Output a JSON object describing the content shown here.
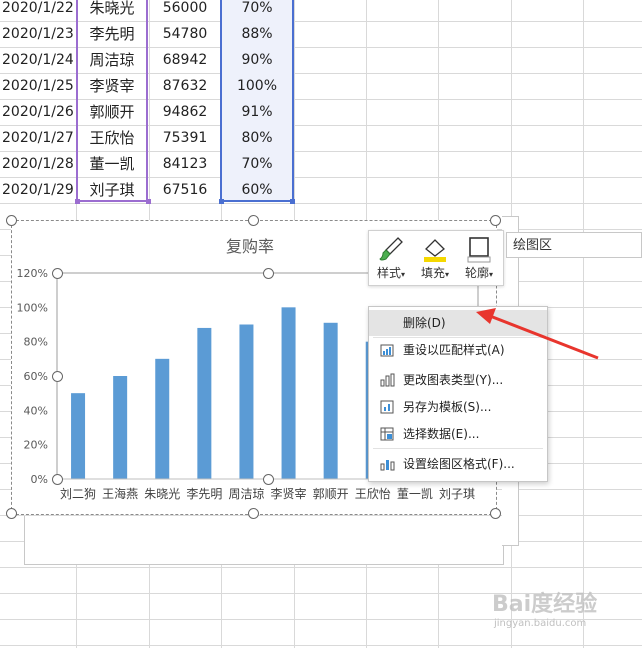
{
  "table": {
    "rows": [
      {
        "date": "2020/1/22",
        "name": "朱晓光",
        "value": "56000",
        "pct": "70%"
      },
      {
        "date": "2020/1/23",
        "name": "李先明",
        "value": "54780",
        "pct": "88%"
      },
      {
        "date": "2020/1/24",
        "name": "周洁琼",
        "value": "68942",
        "pct": "90%"
      },
      {
        "date": "2020/1/25",
        "name": "李贤宰",
        "value": "87632",
        "pct": "100%"
      },
      {
        "date": "2020/1/26",
        "name": "郭顺开",
        "value": "94862",
        "pct": "91%"
      },
      {
        "date": "2020/1/27",
        "name": "王欣怡",
        "value": "75391",
        "pct": "80%"
      },
      {
        "date": "2020/1/28",
        "name": "董一凯",
        "value": "84123",
        "pct": "70%"
      },
      {
        "date": "2020/1/29",
        "name": "刘子琪",
        "value": "67516",
        "pct": "60%"
      }
    ]
  },
  "chart_data": {
    "type": "bar",
    "title": "复购率",
    "categories": [
      "刘二狗",
      "王海燕",
      "朱晓光",
      "李先明",
      "周洁琼",
      "李贤宰",
      "郭顺开",
      "王欣怡",
      "董一凯",
      "刘子琪"
    ],
    "values": [
      0.5,
      0.6,
      0.7,
      0.88,
      0.9,
      1.0,
      0.91,
      0.8,
      0.7,
      0.6
    ],
    "yticks": [
      "0%",
      "20%",
      "40%",
      "60%",
      "80%",
      "100%",
      "120%"
    ],
    "ylim": [
      0,
      1.2
    ],
    "xlabel": "",
    "ylabel": "",
    "grid": false,
    "color": "#5b9bd5"
  },
  "toolbar": {
    "style_label": "样式",
    "fill_label": "填充",
    "outline_label": "轮廓",
    "element_value": "绘图区"
  },
  "menu": {
    "items": [
      {
        "label": "删除(D)",
        "icon": "none"
      },
      {
        "label": "重设以匹配样式(A)",
        "icon": "reset-style-icon"
      },
      {
        "label": "更改图表类型(Y)...",
        "icon": "chart-type-icon"
      },
      {
        "label": "另存为模板(S)...",
        "icon": "template-icon"
      },
      {
        "label": "选择数据(E)...",
        "icon": "select-data-icon"
      },
      {
        "label": "设置绘图区格式(F)...",
        "icon": "format-area-icon"
      }
    ]
  },
  "annotation": {
    "arrow_color": "#e8352d"
  },
  "watermark": {
    "brand": "Bai度经验",
    "url": "jingyan.baidu.com"
  }
}
